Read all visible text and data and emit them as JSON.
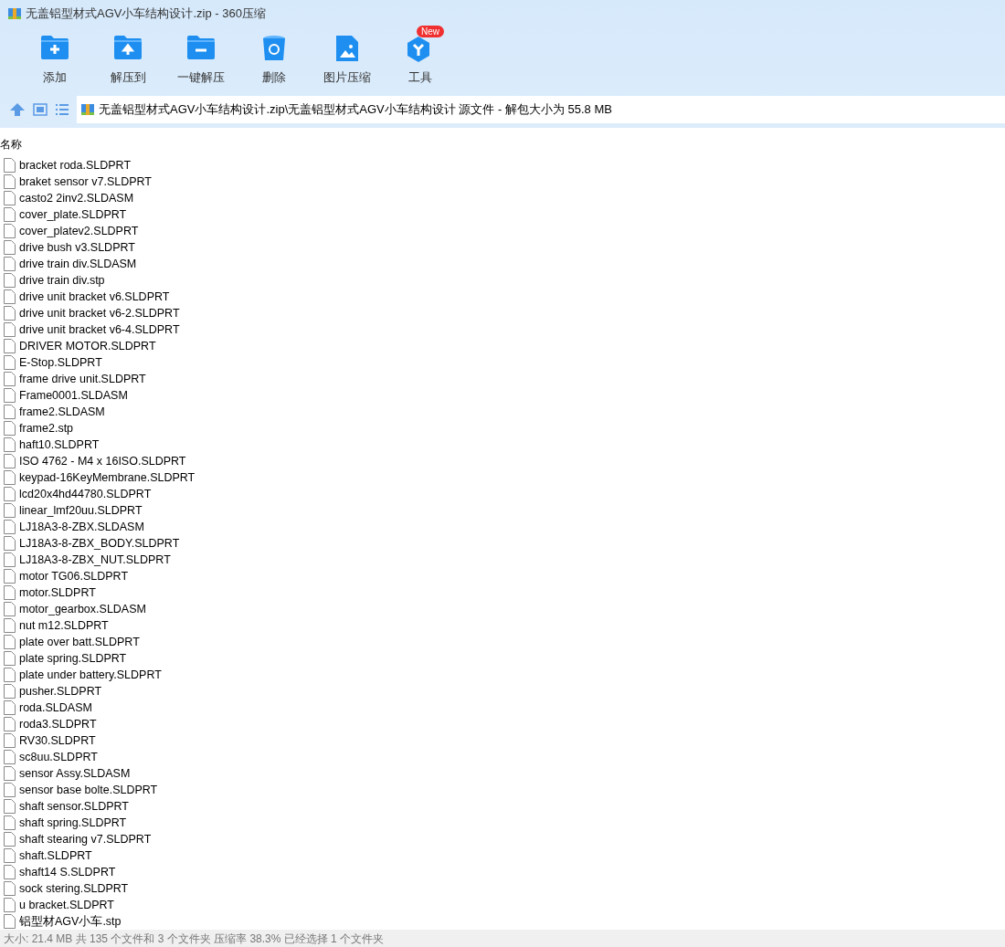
{
  "window": {
    "title": "无盖铝型材式AGV小车结构设计.zip - 360压缩"
  },
  "toolbar": [
    {
      "kind": "add",
      "label": "添加"
    },
    {
      "kind": "extract",
      "label": "解压到"
    },
    {
      "kind": "oneclick",
      "label": "一键解压"
    },
    {
      "kind": "delete",
      "label": "删除"
    },
    {
      "kind": "image",
      "label": "图片压缩"
    },
    {
      "kind": "tools",
      "label": "工具",
      "badge": "New"
    }
  ],
  "address": {
    "path": "无盖铝型材式AGV小车结构设计.zip\\无盖铝型材式AGV小车结构设计 源文件 - 解包大小为 55.8 MB"
  },
  "table": {
    "columns": [
      "名称"
    ],
    "rows": [
      "bracket roda.SLDPRT",
      "braket sensor v7.SLDPRT",
      "casto2 2inv2.SLDASM",
      "cover_plate.SLDPRT",
      "cover_platev2.SLDPRT",
      "drive bush v3.SLDPRT",
      "drive train div.SLDASM",
      "drive train div.stp",
      "drive unit bracket v6.SLDPRT",
      "drive unit bracket v6-2.SLDPRT",
      "drive unit bracket v6-4.SLDPRT",
      "DRIVER MOTOR.SLDPRT",
      "E-Stop.SLDPRT",
      "frame drive unit.SLDPRT",
      "Frame0001.SLDASM",
      "frame2.SLDASM",
      "frame2.stp",
      "haft10.SLDPRT",
      "ISO 4762 - M4 x 16ISO.SLDPRT",
      "keypad-16KeyMembrane.SLDPRT",
      "lcd20x4hd44780.SLDPRT",
      "linear_lmf20uu.SLDPRT",
      "LJ18A3-8-ZBX.SLDASM",
      "LJ18A3-8-ZBX_BODY.SLDPRT",
      "LJ18A3-8-ZBX_NUT.SLDPRT",
      "motor TG06.SLDPRT",
      "motor.SLDPRT",
      "motor_gearbox.SLDASM",
      "nut m12.SLDPRT",
      "plate over batt.SLDPRT",
      "plate spring.SLDPRT",
      "plate under battery.SLDPRT",
      "pusher.SLDPRT",
      "roda.SLDASM",
      "roda3.SLDPRT",
      "RV30.SLDPRT",
      "sc8uu.SLDPRT",
      "sensor Assy.SLDASM",
      "sensor base bolte.SLDPRT",
      "shaft sensor.SLDPRT",
      "shaft spring.SLDPRT",
      "shaft stearing v7.SLDPRT",
      "shaft.SLDPRT",
      "shaft14 S.SLDPRT",
      "sock stering.SLDPRT",
      "u bracket.SLDPRT",
      "铝型材AGV小车.stp"
    ]
  },
  "status_bar": "大小: 21.4 MB 共 135 个文件和 3 个文件夹 压缩率 38.3% 已经选择 1 个文件夹"
}
